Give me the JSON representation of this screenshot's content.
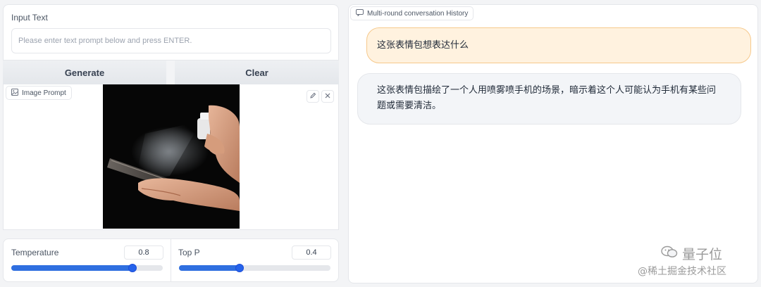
{
  "input": {
    "label": "Input Text",
    "placeholder": "Please enter text prompt below and press ENTER."
  },
  "buttons": {
    "generate": "Generate",
    "clear": "Clear"
  },
  "image_prompt": {
    "label": "Image Prompt"
  },
  "sliders": {
    "temperature": {
      "label": "Temperature",
      "value": "0.8",
      "fraction": 0.8
    },
    "top_p": {
      "label": "Top P",
      "value": "0.4",
      "fraction": 0.4
    }
  },
  "chat": {
    "label": "Multi-round conversation History",
    "messages": [
      {
        "role": "user",
        "text": "这张表情包想表达什么"
      },
      {
        "role": "assistant",
        "text": "这张表情包描绘了一个人用喷雾喷手机的场景，暗示着这个人可能认为手机有某些问题或需要清洁。"
      }
    ]
  },
  "watermark": {
    "line1": "量子位",
    "line2": "@稀土掘金技术社区"
  },
  "icons": {
    "image": "image-icon",
    "chat": "chat-icon",
    "edit": "pencil-icon",
    "close": "close-icon"
  },
  "colors": {
    "accent": "#2563eb",
    "user_bubble": "#fff2df",
    "user_bubble_border": "#f6c98c",
    "bot_bubble": "#f3f5f8"
  }
}
